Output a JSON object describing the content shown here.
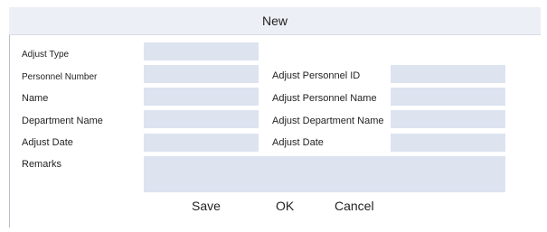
{
  "dialog": {
    "title": "New"
  },
  "form": {
    "adjust_type_label": "Adjust Type",
    "personnel_number_label": "Personnel Number",
    "name_label": "Name",
    "department_name_label": "Department Name",
    "adjust_date_label": "Adjust Date",
    "remarks_label": "Remarks",
    "adjust_personnel_id_label": "Adjust Personnel ID",
    "adjust_personnel_name_label": "Adjust Personnel Name",
    "adjust_department_name_label": "Adjust Department Name",
    "adjust_date_right_label": "Adjust Date",
    "adjust_type_value": "",
    "personnel_number_value": "",
    "name_value": "",
    "department_name_value": "",
    "adjust_date_value": "",
    "adjust_personnel_id_value": "",
    "adjust_personnel_name_value": "",
    "adjust_department_name_value": "",
    "adjust_date_right_value": "",
    "remarks_value": ""
  },
  "buttons": {
    "save": "Save",
    "ok": "OK",
    "cancel": "Cancel"
  },
  "colors": {
    "field_bg": "#dde4f0",
    "titlebar_bg": "#eceff5"
  }
}
